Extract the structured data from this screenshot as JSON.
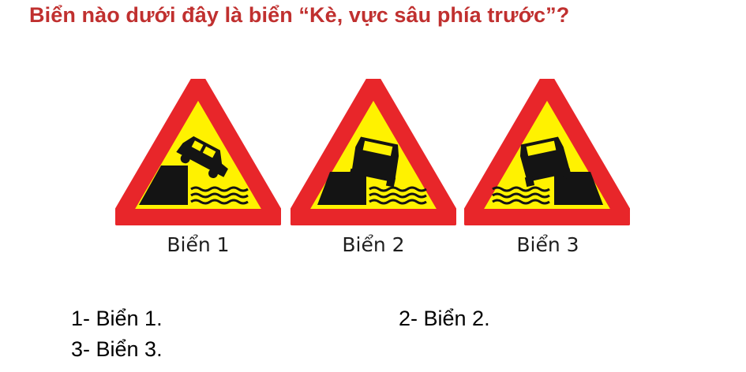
{
  "question": "Biển nào dưới đây là biển “Kè, vực sâu phía trước”?",
  "signs": [
    {
      "label": "Biển 1",
      "icon": "embankment-left-car-tilting-right-icon"
    },
    {
      "label": "Biển 2",
      "icon": "embankment-left-car-falling-icon"
    },
    {
      "label": "Biển 3",
      "icon": "embankment-right-car-falling-icon"
    }
  ],
  "answers": [
    {
      "text": "1- Biển 1."
    },
    {
      "text": "2- Biển 2."
    },
    {
      "text": "3- Biển 3."
    }
  ],
  "colors": {
    "question": "#c0302f",
    "sign_border": "#e8262a",
    "sign_fill": "#fff200",
    "symbol": "#141414"
  }
}
